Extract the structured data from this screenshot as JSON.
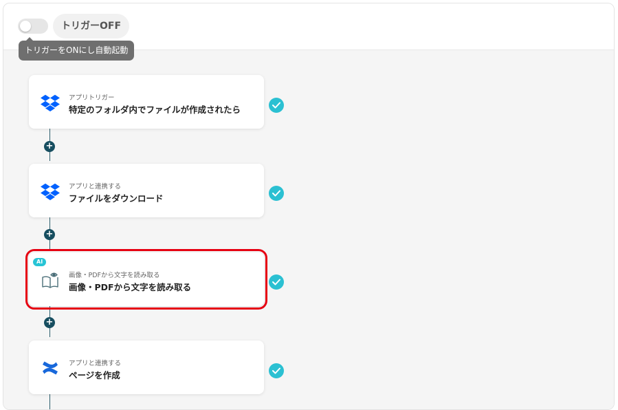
{
  "header": {
    "trigger_toggle": {
      "state": "off"
    },
    "trigger_status_label": "トリガーOFF",
    "tooltip": "トリガーをONにし自動起動"
  },
  "colors": {
    "accent_teal": "#2bc0d2",
    "connector": "#174e60",
    "selection_outline": "#e60012",
    "dropbox_blue": "#0061fe",
    "confluence_blue": "#1868db"
  },
  "flow": {
    "steps": [
      {
        "icon": "dropbox-icon",
        "subtitle": "アプリトリガー",
        "title": "特定のフォルダ内でファイルが作成されたら",
        "status": "complete"
      },
      {
        "icon": "dropbox-icon",
        "subtitle": "アプリと連携する",
        "title": "ファイルをダウンロード",
        "status": "complete"
      },
      {
        "icon": "ocr-book-eye-icon",
        "badge": "AI",
        "subtitle": "画像・PDFから文字を読み取る",
        "title": "画像・PDFから文字を読み取る",
        "status": "complete",
        "selected": true
      },
      {
        "icon": "confluence-icon",
        "subtitle": "アプリと連携する",
        "title": "ページを作成",
        "status": "complete"
      }
    ],
    "add_step_label": "+"
  }
}
